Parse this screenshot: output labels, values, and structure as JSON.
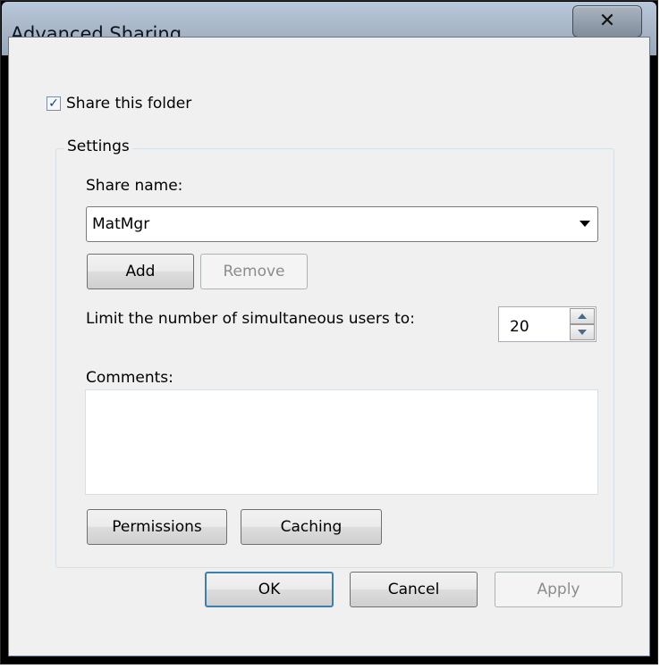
{
  "window": {
    "title": "Advanced Sharing",
    "close_glyph": "✕"
  },
  "share": {
    "checkbox_label": "Share this folder",
    "checked": true,
    "check_glyph": "✓"
  },
  "settings": {
    "legend": "Settings",
    "share_name_label": "Share name:",
    "share_name_value": "MatMgr",
    "add_label": "Add",
    "remove_label": "Remove",
    "limit_label": "Limit the number of simultaneous users to:",
    "limit_value": "20",
    "comments_label": "Comments:",
    "comments_value": "",
    "permissions_label": "Permissions",
    "caching_label": "Caching"
  },
  "footer": {
    "ok_label": "OK",
    "cancel_label": "Cancel",
    "apply_label": "Apply"
  },
  "icons": {
    "dropdown": "chevron-down-icon",
    "spin_up": "spin-up-icon",
    "spin_down": "spin-down-icon",
    "close": "close-icon",
    "check": "checkmark-icon"
  },
  "colors": {
    "titlebar": "#aab8c8",
    "dialog_bg": "#f0f0f0",
    "default_button_border": "#3c7fb1",
    "disabled_text": "#8c8c8c"
  }
}
